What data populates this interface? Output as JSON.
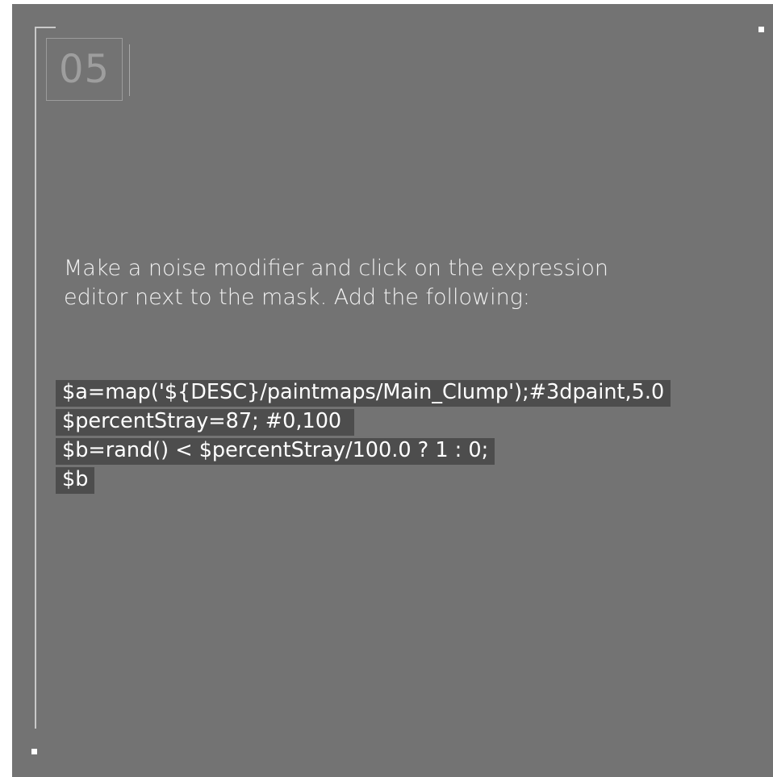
{
  "step": {
    "number": "05"
  },
  "instruction": {
    "line1": "Make a noise modifier and click on the expression",
    "line2": "editor next to the mask. Add the following:"
  },
  "code": {
    "lines": [
      "$a=map('${DESC}/paintmaps/Main_Clump');#3dpaint,5.0",
      "$percentStray=87; #0,100 ",
      "$b=rand() < $percentStray/100.0 ? 1 : 0;",
      "$b"
    ]
  },
  "colors": {
    "card_background": "#737373",
    "code_highlight": "#4d4d4d",
    "frame_line": "#c9c9c9",
    "text": "#f2f2f2"
  }
}
